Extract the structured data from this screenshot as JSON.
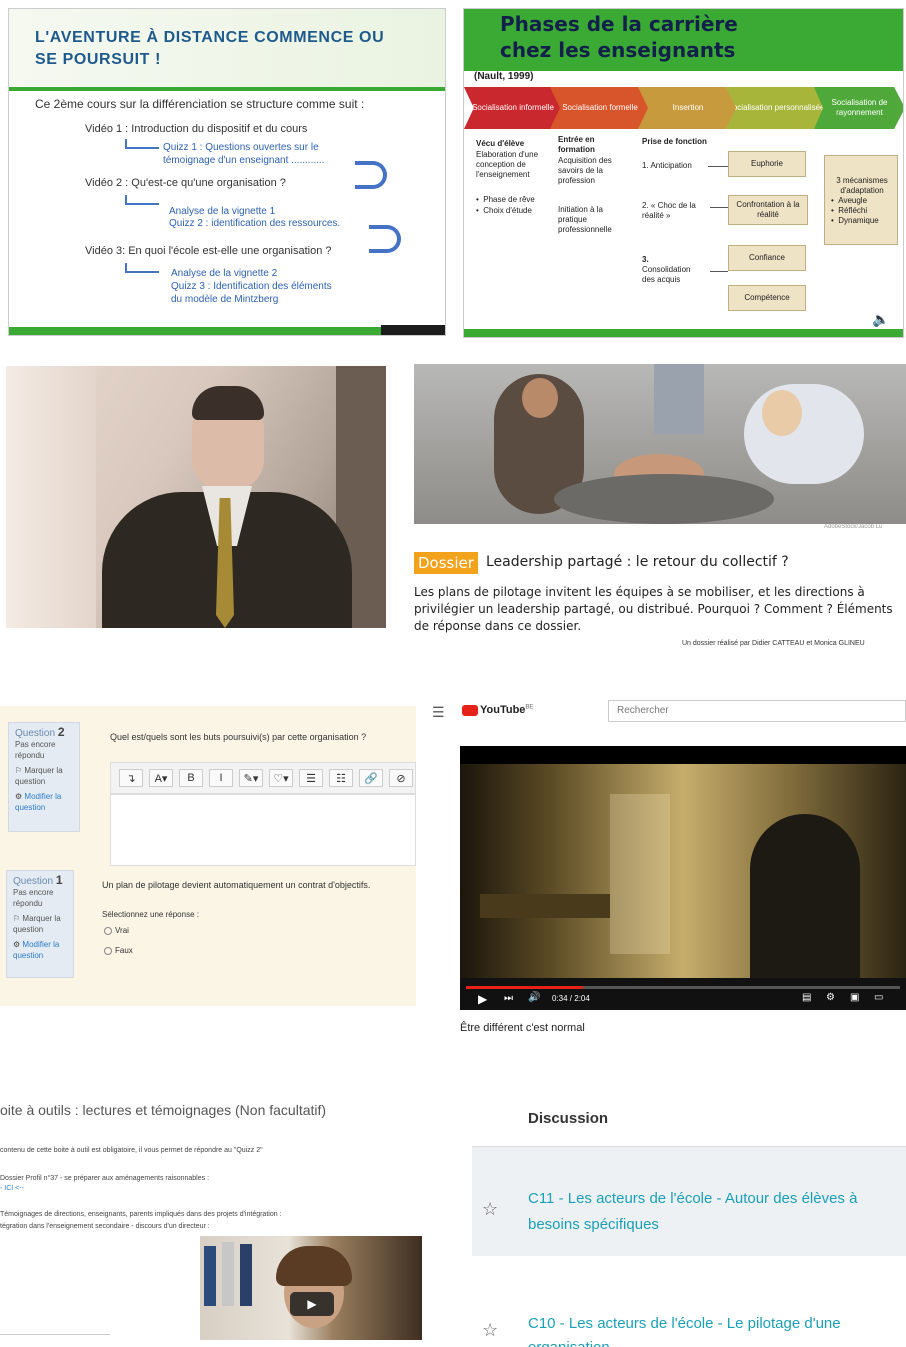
{
  "slide1": {
    "title": "L'aventure à distance commence ou se poursuit  !",
    "intro": "Ce 2ème cours sur la différenciation se structure comme suit :",
    "items": [
      {
        "video": "Vidéo 1 : Introduction du dispositif et du cours",
        "subs": [
          "Quizz 1 : Questions ouvertes sur le",
          "témoignage d'un enseignant ............"
        ]
      },
      {
        "video": "Vidéo 2 : Qu'est-ce qu'une organisation ?",
        "subs": [
          "Analyse de la vignette 1",
          "Quizz 2 : identification des ressources."
        ]
      },
      {
        "video": "Vidéo 3: En quoi l'école est-elle une organisation ?",
        "subs": [
          "Analyse de la vignette 2",
          "Quizz 3  :  Identification des éléments",
          "du modèle de Mintzberg"
        ]
      }
    ]
  },
  "slide2": {
    "title_line1": "Phases de la carrière",
    "title_line2": "chez les enseignants",
    "reference": "(Nault, 1999)",
    "phases": [
      {
        "label": "Socialisation informelle",
        "color": "#c9282e"
      },
      {
        "label": "Socialisation formelle",
        "color": "#d8552b"
      },
      {
        "label": "Insertion",
        "color": "#c79a3d"
      },
      {
        "label": "Socialisation personnalisée",
        "color": "#a7b53b"
      },
      {
        "label": "Socialisation de rayonnement",
        "color": "#4fa93a"
      }
    ],
    "col1_head": "Vécu d'élève",
    "col1_text": [
      "Elaboration d'une",
      "conception de",
      "l'enseignement"
    ],
    "col1_bullets": [
      "Phase de rêve",
      "Choix d'étude"
    ],
    "col2_head": [
      "Entrée en",
      "formation"
    ],
    "col2_text": [
      "Acquisition des",
      "savoirs de la",
      "profession"
    ],
    "col2_text2": [
      "Initiation à la",
      "pratique",
      "professionnelle"
    ],
    "col3_head": "Prise de fonction",
    "steps": [
      "1. Anticipation",
      "2. « Choc de la",
      "réalité »",
      "3.",
      "Consolidation",
      "des acquis"
    ],
    "boxes": [
      "Euphorie",
      "Confrontation à la réalité",
      "Confiance",
      "Compétence"
    ],
    "mech_title": [
      "3 mécanismes",
      "d'adaptation"
    ],
    "mech_items": [
      "Aveugle",
      "Réfléchi",
      "Dynamique"
    ]
  },
  "dossier": {
    "badge": "Dossier",
    "title": "Leadership partagé : le retour du collectif ?",
    "text": "Les plans de pilotage invitent les équipes à se mobiliser, et les directions à privilégier un leadership partagé, ou distribué. Pourquoi ? Comment ? Éléments de réponse dans ce dossier.",
    "author": "Un dossier réalisé par Didier CATTEAU et Monica GLINEU",
    "credit": "AdobeStock/Jacob Lu"
  },
  "quiz": {
    "q2": {
      "label": "Question",
      "num": "2",
      "status": [
        "Pas encore",
        "répondu"
      ],
      "mark": [
        "Marquer la",
        "question"
      ],
      "edit": [
        "Modifier la",
        "question"
      ],
      "text": "Quel est/quels sont les buts poursuivi(s) par cette organisation ?"
    },
    "q1": {
      "label": "Question",
      "num": "1",
      "status": [
        "Pas encore",
        "répondu"
      ],
      "mark": [
        "Marquer la",
        "question"
      ],
      "edit": [
        "Modifier la",
        "question"
      ],
      "text": "Un plan de pilotage devient automatiquement un contrat d'objectifs.",
      "select": "Sélectionnez une réponse :",
      "options": [
        "Vrai",
        "Faux"
      ]
    },
    "toolbar": [
      "↴",
      "A▾",
      "B",
      "I",
      "✎▾",
      "♡▾",
      "☰",
      "☷",
      "🔗",
      "⊘"
    ]
  },
  "youtube": {
    "brand": "YouTube",
    "region": "BE",
    "search_placeholder": "Rechercher",
    "time": "0:34 / 2:04",
    "video_title": "Être différent c'est normal",
    "progress": 0.27
  },
  "toolbox": {
    "title": "oite à outils : lectures et témoignages (Non facultatif)",
    "lines": [
      "contenu de cette boite à outil est obligatoire, il vous permet de répondre au \"Quizz 2\"",
      "Dossier Profil n°37 - se préparer aux aménagements raisonnables :",
      "- ICI <--",
      "Témoignages de directions, enseignants, parents impliqués dans des projets d'intégration :",
      "tégration dans l'enseignement secondaire - discours d'un directeur :"
    ]
  },
  "discussion": {
    "heading": "Discussion",
    "items": [
      {
        "line1": "C11 - Les acteurs de l'école - Autour des élèves à",
        "line2": "besoins spécifiques"
      },
      {
        "line1": "C10 - Les acteurs de l'école - Le pilotage d'une",
        "line2": "organisation"
      }
    ]
  }
}
